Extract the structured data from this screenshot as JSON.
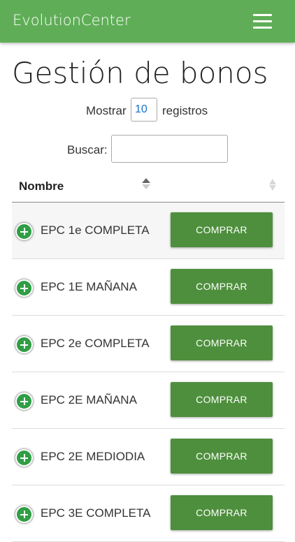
{
  "navbar": {
    "brand": "EvolutionCenter",
    "menu_icon": "hamburger-menu-icon"
  },
  "page": {
    "title": "Gestión de bonos"
  },
  "length": {
    "prefix": "Mostrar",
    "value": "10",
    "suffix": "registros"
  },
  "search": {
    "label": "Buscar:",
    "value": ""
  },
  "table": {
    "header": {
      "name": "Nombre"
    },
    "rows": [
      {
        "name": "EPC 1e COMPLETA",
        "action": "COMPRAR"
      },
      {
        "name": "EPC 1E MAÑANA",
        "action": "COMPRAR"
      },
      {
        "name": "EPC 2e COMPLETA",
        "action": "COMPRAR"
      },
      {
        "name": "EPC 2E MAÑANA",
        "action": "COMPRAR"
      },
      {
        "name": "EPC 2E MEDIODIA",
        "action": "COMPRAR"
      },
      {
        "name": "EPC 3E COMPLETA",
        "action": "COMPRAR"
      }
    ]
  },
  "colors": {
    "navbar": "#5fae57",
    "button": "#4e8f3d",
    "expand_icon": "#2f9e44",
    "link_value": "#1a73c8"
  }
}
